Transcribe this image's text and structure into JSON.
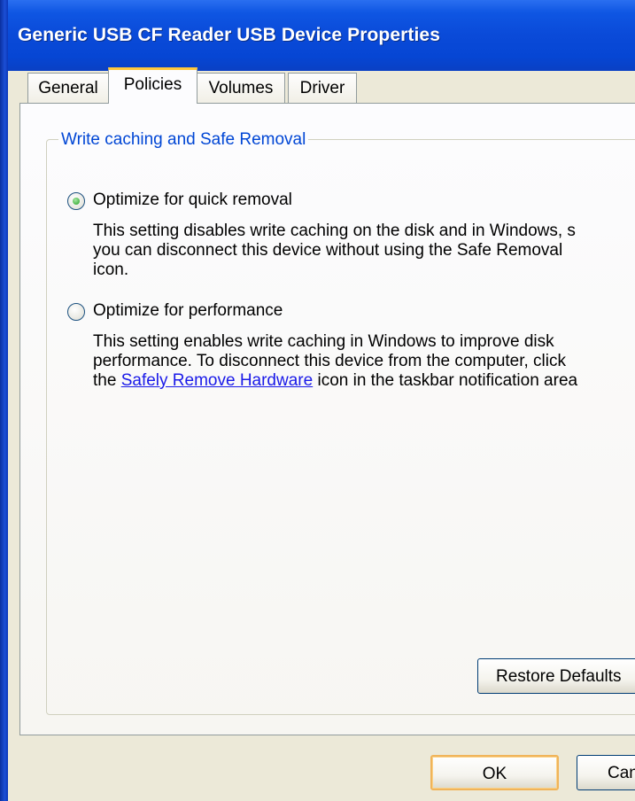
{
  "window": {
    "title": "Generic USB CF Reader USB Device Properties"
  },
  "tabs": [
    {
      "label": "General"
    },
    {
      "label": "Policies",
      "active": true
    },
    {
      "label": "Volumes"
    },
    {
      "label": "Driver"
    }
  ],
  "group": {
    "legend": "Write caching and Safe Removal"
  },
  "options": [
    {
      "label": "Optimize for quick removal",
      "checked": true,
      "description": [
        "This setting disables write caching on the disk and in Windows, s",
        "you can disconnect this device without using the Safe Removal",
        "icon."
      ]
    },
    {
      "label": "Optimize for performance",
      "checked": false,
      "description_line1": "This setting enables write caching in Windows to improve disk",
      "description_line2": "performance. To disconnect this device from the computer, click",
      "description_line3_prefix": "the ",
      "description_link": "Safely Remove Hardware",
      "description_line3_suffix": " icon in the taskbar notification area"
    }
  ],
  "buttons": {
    "restore_defaults": "Restore Defaults",
    "ok": "OK",
    "cancel": "Cancel"
  },
  "colors": {
    "titlebar": "#0a4ad8",
    "legend_text": "#0046d5",
    "link": "#1a1ae8",
    "active_tab_accent": "#ffc83c"
  }
}
